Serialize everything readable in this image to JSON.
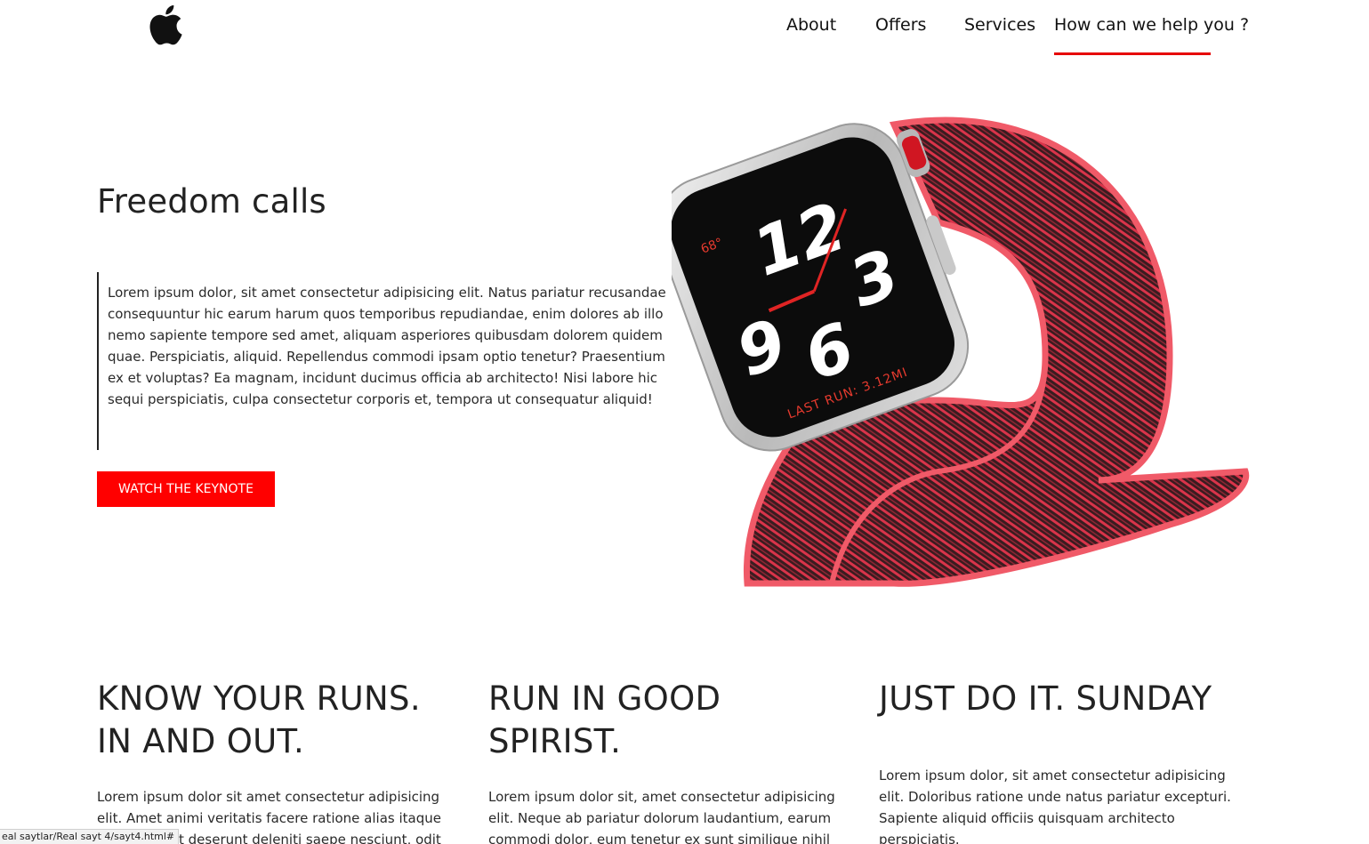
{
  "header": {
    "logo_icon": "apple-logo-icon",
    "nav": [
      {
        "label": "About"
      },
      {
        "label": "Offers"
      },
      {
        "label": "Services"
      },
      {
        "label": "How can we help you ?"
      }
    ],
    "active_nav_index": 3,
    "accent_color": "#e60000"
  },
  "hero": {
    "title": "Freedom calls",
    "text": "Lorem ipsum dolor, sit amet consectetur adipisicing elit. Natus pariatur recusandae consequuntur hic earum harum quos temporibus repudiandae, enim dolores ab illo nemo sapiente tempore sed amet, aliquam asperiores quibusdam dolorem quidem quae. Perspiciatis, aliquid. Repellendus commodi ipsam optio tenetur? Praesentium ex et voluptas? Ea magnam, incidunt ducimus officia ab architecto! Nisi labore hic sequi perspiciatis, culpa consectetur corporis et, tempora ut consequatur aliquid!",
    "cta_label": "WATCH THE KEYNOTE",
    "cta_color": "#ff0000",
    "image_icon": "apple-watch-nike-image",
    "watch_face": {
      "temperature": "68°",
      "numbers": [
        "12",
        "3",
        "9",
        "6"
      ],
      "last_run": "LAST RUN: 3.12MI"
    }
  },
  "features": [
    {
      "title_line1": "KNOW YOUR RUNS.",
      "title_line2": "IN AND OUT.",
      "text": "Lorem ipsum dolor sit amet consectetur adipisicing elit. Amet animi veritatis facere ratione alias itaque quisquam iet deserunt deleniti saepe nesciunt, odit"
    },
    {
      "title_line1": "RUN IN GOOD",
      "title_line2": "SPIRIST.",
      "text": "Lorem ipsum dolor sit, amet consectetur adipisicing elit. Neque ab pariatur dolorum laudantium, earum commodi dolor, eum tenetur ex sunt similique nihil deserunt"
    },
    {
      "title_line1": "JUST DO IT. SUNDAY",
      "title_line2": "",
      "text": "Lorem ipsum dolor, sit amet consectetur adipisicing elit. Doloribus ratione unde natus pariatur excepturi. Sapiente aliquid officiis quisquam architecto perspiciatis."
    }
  ],
  "status_bar": {
    "url": "eal saytlar/Real sayt 4/sayt4.html#"
  }
}
